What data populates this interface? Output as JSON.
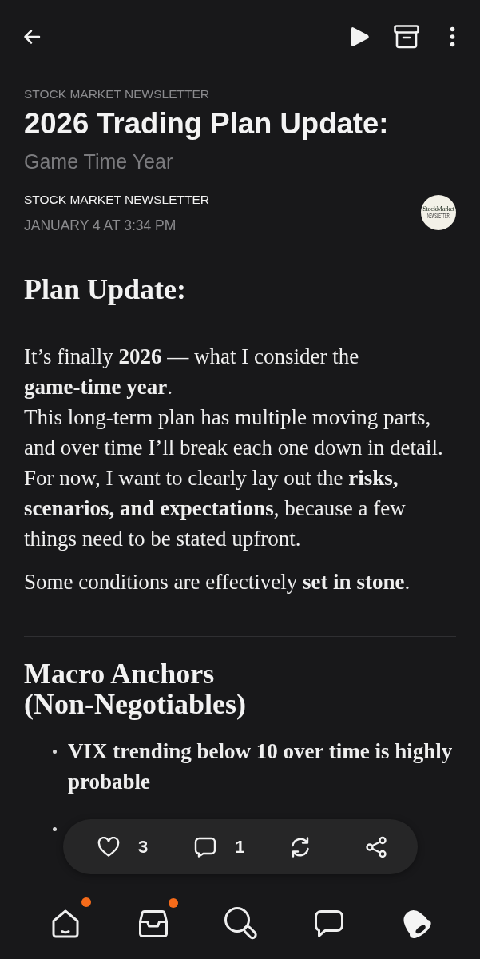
{
  "top_bar": {
    "actions": [
      {
        "kind": "back"
      },
      {
        "kind": "play"
      },
      {
        "kind": "archive"
      },
      {
        "kind": "more"
      }
    ]
  },
  "header": {
    "publication": "STOCK MARKET NEWSLETTER",
    "title": "2026 Trading Plan Update:",
    "subtitle": "Game Time Year",
    "author": "STOCK MARKET NEWSLETTER",
    "date": "JANUARY 4 AT 3:34 PM",
    "logo": {
      "name": "StockMarket",
      "tagline": "NEWSLETTER"
    }
  },
  "body": {
    "sections": [
      {
        "heading": "Plan Update:",
        "paragraphs": [
          {
            "lines": [
              "It’s finally **2026** — what I consider the **game-time year**.",
              "This long-term plan has multiple moving parts, and over time I’ll break each one down in detail. For now, I want to clearly lay out the **risks, scenarios, and expectations**, because a few things need to be stated upfront."
            ]
          },
          {
            "lines": [
              "Some conditions are effectively **set in stone**."
            ]
          }
        ]
      },
      {
        "heading": "Macro Anchors (Non-Negotiables)",
        "bullets": [
          {
            "kind": "text",
            "text": "VIX trending below 10 over time is highly probable"
          },
          {
            "kind": "hidden"
          }
        ]
      }
    ]
  },
  "action_bar": {
    "actions": [
      {
        "kind": "like",
        "count": "3"
      },
      {
        "kind": "comment",
        "count": "1"
      },
      {
        "kind": "restack"
      },
      {
        "kind": "share"
      }
    ]
  },
  "bottom_nav": {
    "items": [
      {
        "kind": "home",
        "selected": false,
        "badge": true
      },
      {
        "kind": "inbox",
        "selected": false,
        "badge": true
      },
      {
        "kind": "search",
        "selected": false,
        "badge": false
      },
      {
        "kind": "chat",
        "selected": false,
        "badge": false
      },
      {
        "kind": "activity",
        "selected": true,
        "badge": false
      }
    ]
  }
}
